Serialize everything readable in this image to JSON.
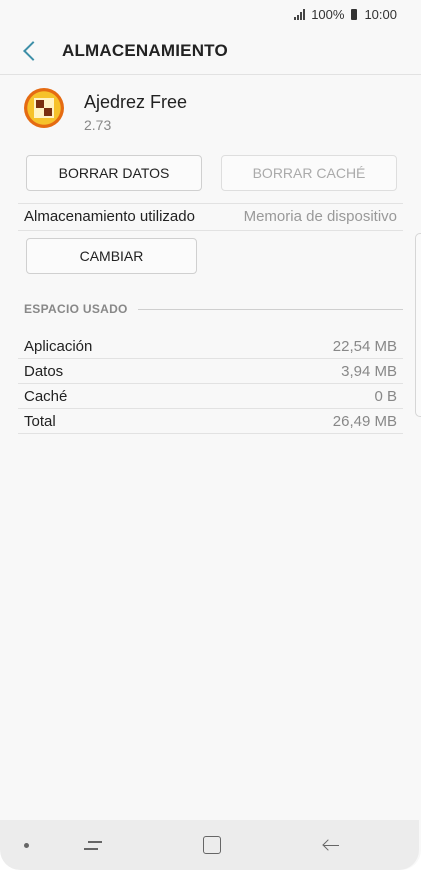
{
  "status": {
    "signal": "signal-icon",
    "battery_pct": "100%",
    "time": "10:00"
  },
  "header": {
    "title": "ALMACENAMIENTO"
  },
  "app": {
    "name": "Ajedrez Free",
    "version": "2.73"
  },
  "actions": {
    "clear_data": "BORRAR DATOS",
    "clear_cache": "BORRAR CACHÉ"
  },
  "storage": {
    "label": "Almacenamiento utilizado",
    "value": "Memoria de dispositivo",
    "change": "CAMBIAR"
  },
  "section": {
    "label": "ESPACIO USADO"
  },
  "usage": [
    {
      "label": "Aplicación",
      "value": "22,54 MB"
    },
    {
      "label": "Datos",
      "value": "3,94 MB"
    },
    {
      "label": "Caché",
      "value": "0 B"
    },
    {
      "label": "Total",
      "value": "26,49 MB"
    }
  ],
  "colors": {
    "accent": "#3d8fa8",
    "background": "#f8f8f8",
    "nav": "#ececec"
  }
}
